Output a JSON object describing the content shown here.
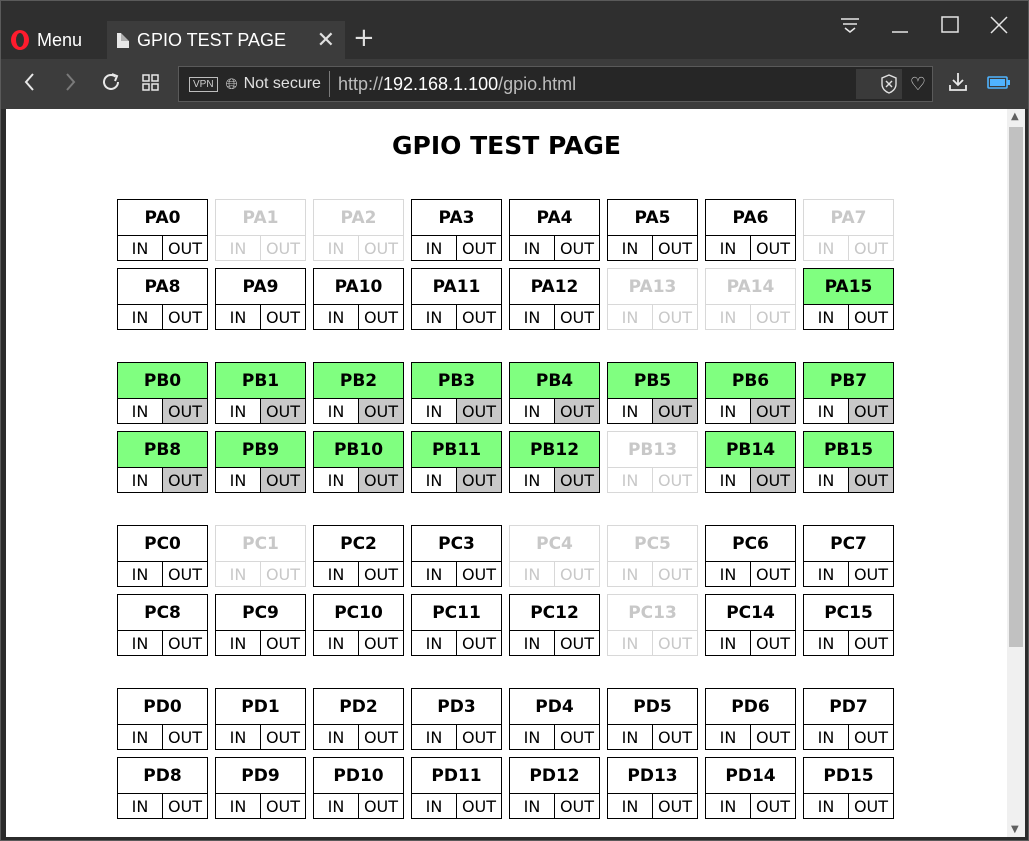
{
  "browser": {
    "menu_label": "Menu",
    "tab_title": "GPIO TEST PAGE",
    "vpn_label": "VPN",
    "security_label": "Not secure",
    "url_scheme": "http://",
    "url_host": "192.168.1.100",
    "url_path": "/gpio.html"
  },
  "page": {
    "title": "GPIO TEST PAGE",
    "in_label": "IN",
    "out_label": "OUT"
  },
  "ports": [
    {
      "rows": [
        [
          {
            "name": "PA0",
            "state": "normal"
          },
          {
            "name": "PA1",
            "state": "disabled"
          },
          {
            "name": "PA2",
            "state": "disabled"
          },
          {
            "name": "PA3",
            "state": "normal"
          },
          {
            "name": "PA4",
            "state": "normal"
          },
          {
            "name": "PA5",
            "state": "normal"
          },
          {
            "name": "PA6",
            "state": "normal"
          },
          {
            "name": "PA7",
            "state": "disabled"
          }
        ],
        [
          {
            "name": "PA8",
            "state": "normal"
          },
          {
            "name": "PA9",
            "state": "normal"
          },
          {
            "name": "PA10",
            "state": "normal"
          },
          {
            "name": "PA11",
            "state": "normal"
          },
          {
            "name": "PA12",
            "state": "normal"
          },
          {
            "name": "PA13",
            "state": "disabled"
          },
          {
            "name": "PA14",
            "state": "disabled"
          },
          {
            "name": "PA15",
            "state": "active",
            "mode": "none"
          }
        ]
      ]
    },
    {
      "rows": [
        [
          {
            "name": "PB0",
            "state": "active",
            "mode": "out"
          },
          {
            "name": "PB1",
            "state": "active",
            "mode": "out"
          },
          {
            "name": "PB2",
            "state": "active",
            "mode": "out"
          },
          {
            "name": "PB3",
            "state": "active",
            "mode": "out"
          },
          {
            "name": "PB4",
            "state": "active",
            "mode": "out"
          },
          {
            "name": "PB5",
            "state": "active",
            "mode": "out"
          },
          {
            "name": "PB6",
            "state": "active",
            "mode": "out"
          },
          {
            "name": "PB7",
            "state": "active",
            "mode": "out"
          }
        ],
        [
          {
            "name": "PB8",
            "state": "active",
            "mode": "out"
          },
          {
            "name": "PB9",
            "state": "active",
            "mode": "out"
          },
          {
            "name": "PB10",
            "state": "active",
            "mode": "out"
          },
          {
            "name": "PB11",
            "state": "active",
            "mode": "out"
          },
          {
            "name": "PB12",
            "state": "active",
            "mode": "out"
          },
          {
            "name": "PB13",
            "state": "disabled"
          },
          {
            "name": "PB14",
            "state": "active",
            "mode": "out"
          },
          {
            "name": "PB15",
            "state": "active",
            "mode": "out"
          }
        ]
      ]
    },
    {
      "rows": [
        [
          {
            "name": "PC0",
            "state": "normal"
          },
          {
            "name": "PC1",
            "state": "disabled"
          },
          {
            "name": "PC2",
            "state": "normal"
          },
          {
            "name": "PC3",
            "state": "normal"
          },
          {
            "name": "PC4",
            "state": "disabled"
          },
          {
            "name": "PC5",
            "state": "disabled"
          },
          {
            "name": "PC6",
            "state": "normal"
          },
          {
            "name": "PC7",
            "state": "normal"
          }
        ],
        [
          {
            "name": "PC8",
            "state": "normal"
          },
          {
            "name": "PC9",
            "state": "normal"
          },
          {
            "name": "PC10",
            "state": "normal"
          },
          {
            "name": "PC11",
            "state": "normal"
          },
          {
            "name": "PC12",
            "state": "normal"
          },
          {
            "name": "PC13",
            "state": "disabled"
          },
          {
            "name": "PC14",
            "state": "normal"
          },
          {
            "name": "PC15",
            "state": "normal"
          }
        ]
      ]
    },
    {
      "rows": [
        [
          {
            "name": "PD0",
            "state": "normal"
          },
          {
            "name": "PD1",
            "state": "normal"
          },
          {
            "name": "PD2",
            "state": "normal"
          },
          {
            "name": "PD3",
            "state": "normal"
          },
          {
            "name": "PD4",
            "state": "normal"
          },
          {
            "name": "PD5",
            "state": "normal"
          },
          {
            "name": "PD6",
            "state": "normal"
          },
          {
            "name": "PD7",
            "state": "normal"
          }
        ],
        [
          {
            "name": "PD8",
            "state": "normal"
          },
          {
            "name": "PD9",
            "state": "normal"
          },
          {
            "name": "PD10",
            "state": "normal"
          },
          {
            "name": "PD11",
            "state": "normal"
          },
          {
            "name": "PD12",
            "state": "normal"
          },
          {
            "name": "PD13",
            "state": "normal"
          },
          {
            "name": "PD14",
            "state": "normal"
          },
          {
            "name": "PD15",
            "state": "normal"
          }
        ]
      ]
    }
  ],
  "colors": {
    "active_pin": "#80ff80",
    "selected_mode": "#c8c8c8",
    "disabled_text": "#c8c8c8"
  },
  "icons": {
    "logo": "opera-logo-icon",
    "back": "chevron-left-icon",
    "forward": "chevron-right-icon",
    "reload": "reload-icon",
    "speed_dial": "grid-icon",
    "security": "globe-icon",
    "adblock": "shield-x-icon",
    "bookmark": "heart-icon",
    "download": "download-icon",
    "battery": "battery-icon"
  }
}
